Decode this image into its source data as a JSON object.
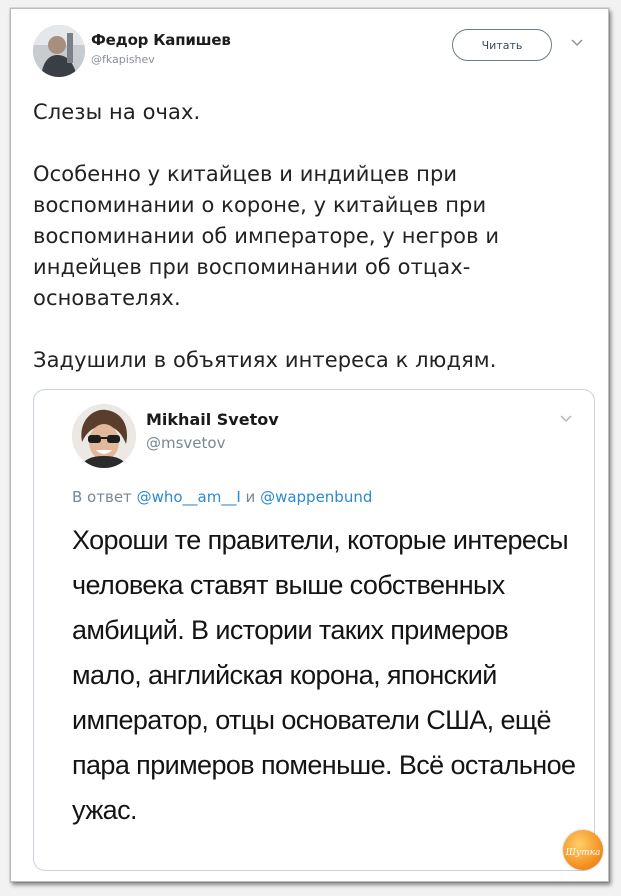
{
  "author": {
    "name": "Федор Капишев",
    "handle": "@fkapishev"
  },
  "follow_button": "Читать",
  "tweet": {
    "paragraphs": [
      "Слезы на очах.",
      "Особенно у китайцев и индийцев при воспоминании о короне, у китайцев при воспоминании об императоре, у негров и индейцев при воспоминании об отцах-основателях.",
      "Задушили в объятиях интереса к людям."
    ]
  },
  "quoted": {
    "name": "Mikhail Svetov",
    "handle": "@msvetov",
    "reply_prefix": "В ответ",
    "reply_mention_1": "@who__am__I",
    "reply_joiner": "и",
    "reply_mention_2": "@wappenbund",
    "text": "Хороши те правители, которые интересы человека ставят выше собственных амбиций. В истории таких примеров мало, английская корона, японский император, отцы основатели США, ещё пара примеров поменьше. Всё остальное ужас."
  },
  "watermark": "Шутка",
  "colors": {
    "mention": "#2b8ad0",
    "muted": "#7b8793",
    "watermark": "#f28a1c"
  },
  "icons": [
    "avatar",
    "chevron-down-icon",
    "watermark-logo"
  ]
}
